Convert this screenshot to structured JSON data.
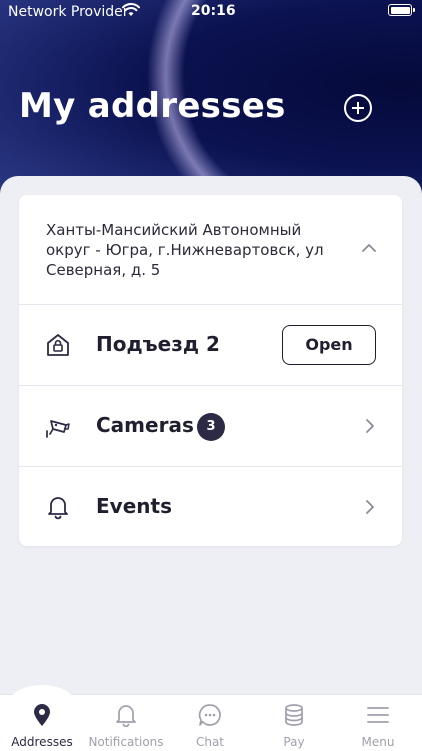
{
  "status_bar": {
    "carrier": "Network Provider",
    "time": "20:16"
  },
  "header": {
    "title": "My addresses"
  },
  "address_card": {
    "address": "Ханты-Мансийский Автономный округ - Югра, г.Нижневартовск, ул Северная, д. 5",
    "entrance": {
      "label": "Подъезд 2",
      "button_label": "Open"
    },
    "cameras": {
      "label": "Cameras",
      "count": "3"
    },
    "events": {
      "label": "Events"
    }
  },
  "tabbar": {
    "tabs": [
      {
        "label": "Addresses",
        "icon": "map-pin-icon",
        "active": true
      },
      {
        "label": "Notifications",
        "icon": "bell-icon",
        "active": false
      },
      {
        "label": "Chat",
        "icon": "chat-bubble-icon",
        "active": false
      },
      {
        "label": "Pay",
        "icon": "coins-stack-icon",
        "active": false
      },
      {
        "label": "Menu",
        "icon": "hamburger-menu-icon",
        "active": false
      }
    ]
  },
  "colors": {
    "header_bg": "#0b1250",
    "primary_dark": "#2c2a44",
    "inactive_tab": "#a0a0ad",
    "page_bg": "#eeeff4"
  }
}
